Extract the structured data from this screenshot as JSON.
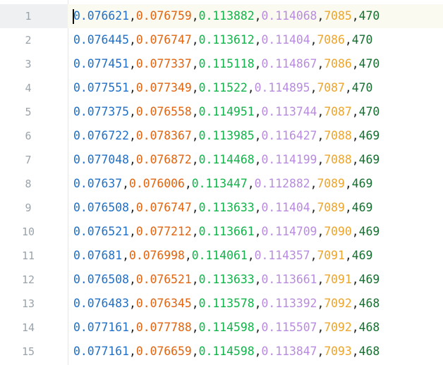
{
  "editor": {
    "current_line": 1,
    "colors": {
      "col1": "#1f6fc6",
      "col2": "#e2640f",
      "col3": "#12b34a",
      "col4": "#b98be0",
      "col5": "#eda52b",
      "col6": "#146f2f",
      "separator": "#222222",
      "line_number": "#9aa3aa",
      "current_line_bg": "#fafaf0"
    },
    "separator": ",",
    "lines": [
      {
        "number": "1",
        "values": [
          "0.076621",
          "0.076759",
          "0.113882",
          "0.114068",
          "7085",
          "470"
        ]
      },
      {
        "number": "2",
        "values": [
          "0.076445",
          "0.076747",
          "0.113612",
          "0.11404",
          "7086",
          "470"
        ]
      },
      {
        "number": "3",
        "values": [
          "0.077451",
          "0.077337",
          "0.115118",
          "0.114867",
          "7086",
          "470"
        ]
      },
      {
        "number": "4",
        "values": [
          "0.077551",
          "0.077349",
          "0.11522",
          "0.114895",
          "7087",
          "470"
        ]
      },
      {
        "number": "5",
        "values": [
          "0.077375",
          "0.076558",
          "0.114951",
          "0.113744",
          "7087",
          "470"
        ]
      },
      {
        "number": "6",
        "values": [
          "0.076722",
          "0.078367",
          "0.113985",
          "0.116427",
          "7088",
          "469"
        ]
      },
      {
        "number": "7",
        "values": [
          "0.077048",
          "0.076872",
          "0.114468",
          "0.114199",
          "7088",
          "469"
        ]
      },
      {
        "number": "8",
        "values": [
          "0.07637",
          "0.076006",
          "0.113447",
          "0.112882",
          "7089",
          "469"
        ]
      },
      {
        "number": "9",
        "values": [
          "0.076508",
          "0.076747",
          "0.113633",
          "0.11404",
          "7089",
          "469"
        ]
      },
      {
        "number": "10",
        "values": [
          "0.076521",
          "0.077212",
          "0.113661",
          "0.114709",
          "7090",
          "469"
        ]
      },
      {
        "number": "11",
        "values": [
          "0.07681",
          "0.076998",
          "0.114061",
          "0.114357",
          "7091",
          "469"
        ]
      },
      {
        "number": "12",
        "values": [
          "0.076508",
          "0.076521",
          "0.113633",
          "0.113661",
          "7091",
          "469"
        ]
      },
      {
        "number": "13",
        "values": [
          "0.076483",
          "0.076345",
          "0.113578",
          "0.113392",
          "7092",
          "468"
        ]
      },
      {
        "number": "14",
        "values": [
          "0.077161",
          "0.077788",
          "0.114598",
          "0.115507",
          "7092",
          "468"
        ]
      },
      {
        "number": "15",
        "values": [
          "0.077161",
          "0.076659",
          "0.114598",
          "0.113847",
          "7093",
          "468"
        ]
      }
    ]
  }
}
